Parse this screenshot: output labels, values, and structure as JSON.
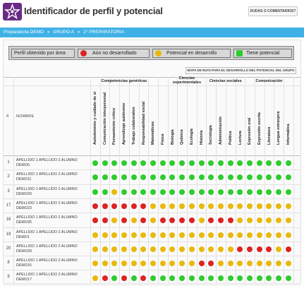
{
  "app": {
    "title": "Identificador de perfil y potencial",
    "help_button": "DUDAS O COMENTARIOS?"
  },
  "breadcrumb": [
    "Preparatoria DEMO",
    "GRUPO A",
    "2° PREPARATORIA"
  ],
  "breadcrumb_separator": "»",
  "legend": {
    "title": "Perfil obtenido por área",
    "items": [
      {
        "label": "Aún no desarrollado",
        "color": "#dd2222"
      },
      {
        "label": "Potencial en desarrollo",
        "color": "#e8b90d"
      },
      {
        "label": "Tiene potencial",
        "color": "#2ecc2e"
      }
    ]
  },
  "roadmap_button": "MAPA DE RUTA PARA EL DESARROLLO DEL POTENCIAL DEL GRUPO",
  "table": {
    "hash_header": "#",
    "name_header": "NOMBRE",
    "groups": [
      {
        "label": "Competencias genéricas",
        "span": 7
      },
      {
        "label": "",
        "span": 1
      },
      {
        "label": "Ciencias experimentales",
        "span": 4
      },
      {
        "label": "Ciencias sociales",
        "span": 4
      },
      {
        "label": "Comunicación",
        "span": 5
      }
    ],
    "subjects": [
      "Autodominio y cuidado de sí",
      "Comunicación interpersonal",
      "Pensamiento crítico",
      "Aprendizaje autónomo",
      "Trabajo colaborativo",
      "Responsabilidad social",
      "Matemáticas",
      "Física",
      "Biología",
      "Química",
      "Ecología",
      "Historia",
      "Sociología",
      "Administración",
      "Política",
      "Lectura",
      "Expresión oral",
      "Expresión escrita",
      "Literatura",
      "Lengua extranjera",
      "Informática"
    ],
    "status_colors": {
      "G": "#2ecc2e",
      "Y": "#e8b90d",
      "R": "#dd2222"
    },
    "rows": [
      {
        "num": "1",
        "name": "APELLIDO 1 APELLIDO 2 ALUMNO DEMO6",
        "status": "GGGGGGGGGGGGGGGGGGGGG"
      },
      {
        "num": "2",
        "name": "APELLIDO 1 APELLIDO 2 ALUMNO DEMO11",
        "status": "GGGGGGGGGGGGGGGGGGGGG"
      },
      {
        "num": "3",
        "name": "APELLIDO 1 APELLIDO 2 ALUMNO DEMO29",
        "status": "GGYGGGGGGGGGGGGGGGGGG"
      },
      {
        "num": "17",
        "name": "APELLIDO 1 APELLIDO 2 ALUMNO DEMO23",
        "status": "RRRRRRYYYYYYYYYYYYYYY"
      },
      {
        "num": "16",
        "name": "APELLIDO 1 APELLIDO 2 ALUMNO DEMO35",
        "status": "RRYRYRYRRRRYRRRYYYYYY"
      },
      {
        "num": "19",
        "name": "APELLIDO 1 APELLIDO 2 ALUMNO DEMO1",
        "status": "YYYYYYYYYYYYYYYYYYYYY"
      },
      {
        "num": "20",
        "name": "APELLIDO 1 APELLIDO 2 ALUMNO DEMO28",
        "status": "YYYYYYYYYYYYYYYRRRRYR"
      },
      {
        "num": "8",
        "name": "APELLIDO 1 APELLIDO 2 ALUMNO DEMO16",
        "status": "YYYYYYYYYYYRRYYYYYYYY"
      },
      {
        "num": "9",
        "name": "APELLIDO 1 APELLIDO 2 ALUMNO DEMO17",
        "status": "YRGRGRGGGGGGGGGGGGGGG"
      }
    ]
  }
}
